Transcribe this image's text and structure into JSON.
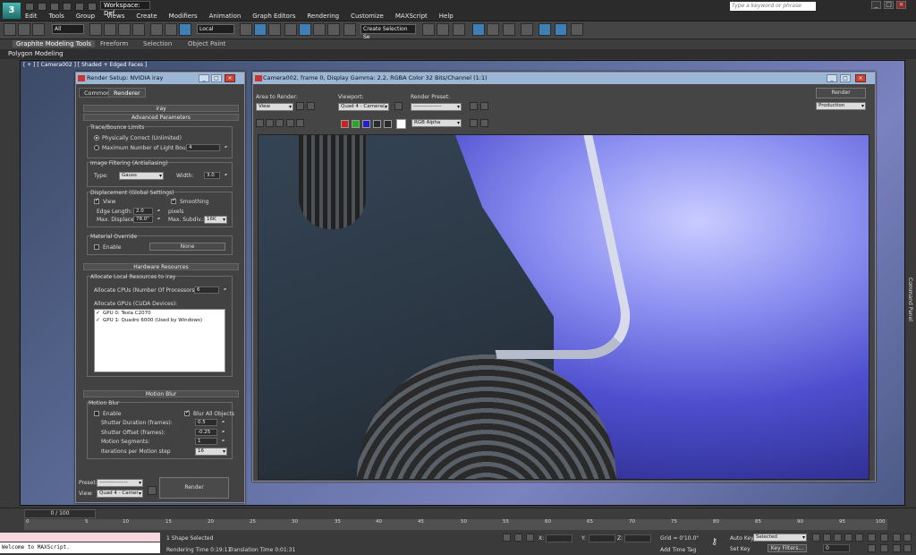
{
  "app": {
    "workspace": "Workspace: Def",
    "search_placeholder": "Type a keyword or phrase",
    "menu": [
      "Edit",
      "Tools",
      "Group",
      "Views",
      "Create",
      "Modifiers",
      "Animation",
      "Graph Editors",
      "Rendering",
      "Customize",
      "MAXScript",
      "Help"
    ]
  },
  "toolbar": {
    "filter_value": "All",
    "coord_value": "Local",
    "selection_set": "Create Selection Se"
  },
  "ribbon": {
    "tabs": [
      "Graphite Modeling Tools",
      "Freeform",
      "Selection",
      "Object Paint"
    ],
    "subbar": "Polygon Modeling"
  },
  "viewport": {
    "label": "[ + ] [ Camera002 ] [ Shaded + Edged Faces ]",
    "command_panel": "Command Panel"
  },
  "render_setup": {
    "title": "Render Setup: NVIDIA iray",
    "tabs": [
      "Common",
      "Renderer"
    ],
    "iray_header": "iray",
    "advanced_header": "Advanced Parameters",
    "trace_group": "Trace/Bounce Limits",
    "physically_correct": "Physically Correct (Unlimited)",
    "max_bounces": "Maximum Number of Light Bounces",
    "max_bounces_value": "4",
    "filtering_group": "Image Filtering (Antialiasing)",
    "type_label": "Type:",
    "type_value": "Gauss",
    "width_label": "Width:",
    "width_value": "3.0",
    "displacement_group": "Displacement (Global Settings)",
    "view_label": "View",
    "smoothing_label": "Smoothing",
    "edge_length_label": "Edge Length:",
    "edge_length_value": "2.0",
    "pixels_label": "pixels",
    "max_displace_label": "Max. Displace:",
    "max_displace_value": "78.0\"",
    "max_subdiv_label": "Max. Subdiv.:",
    "max_subdiv_value": "16K",
    "material_override_group": "Material Override",
    "enable_label": "Enable",
    "none_button": "None",
    "hardware_header": "Hardware Resources",
    "allocate_local": "Allocate Local Resources to iray",
    "allocate_cpus_label": "Allocate CPUs (Number Of Processors):",
    "allocate_cpus_value": "6",
    "allocate_gpus_label": "Allocate GPUs (CUDA Devices):",
    "gpus": [
      "GPU 0: Tesla C2070",
      "GPU 1: Quadro 6000 (Used by Windows)"
    ],
    "motion_header": "Motion Blur",
    "motion_group": "Motion Blur",
    "mb_enable": "Enable",
    "blur_all": "Blur All Objects",
    "shutter_duration_label": "Shutter Duration (frames):",
    "shutter_duration_value": "0.5",
    "shutter_offset_label": "Shutter Offset (frames):",
    "shutter_offset_value": "-0.25",
    "motion_segments_label": "Motion Segments:",
    "motion_segments_value": "1",
    "iterations_label": "Iterations per Motion step",
    "iterations_value": "16",
    "preset_label": "Preset:",
    "preset_value": "----------------",
    "view_bottom_label": "View:",
    "view_bottom_value": "Quad 4 - Camer",
    "render_button": "Render"
  },
  "render_frame": {
    "title": "Camera002, frame 0, Display Gamma: 2.2, RGBA Color 32 Bits/Channel (1:1)",
    "area_label": "Area to Render:",
    "area_value": "View",
    "viewport_label": "Viewport:",
    "viewport_value": "Quad 4 - Camera(",
    "preset_label": "Render Preset:",
    "preset_value": "----------------",
    "render_button": "Render",
    "mode_value": "Production",
    "channel_value": "RGB Alpha"
  },
  "timeline": {
    "slider": "0 / 100",
    "ticks": [
      "0",
      "5",
      "10",
      "15",
      "20",
      "25",
      "30",
      "35",
      "40",
      "45",
      "50",
      "55",
      "60",
      "65",
      "70",
      "75",
      "80",
      "85",
      "90",
      "95",
      "100"
    ]
  },
  "status": {
    "listener_top": "",
    "listener_bottom": "Welcome to MAXScript.",
    "selected": "1 Shape Selected",
    "render_time": "Rendering Time  0:19:11",
    "translation_time": "Translation Time  0:01:31",
    "x_label": "X:",
    "y_label": "Y:",
    "z_label": "Z:",
    "grid": "Grid = 0'10.0\"",
    "add_time_tag": "Add Time Tag",
    "auto_key": "Auto Key",
    "auto_key_value": "Selected",
    "set_key": "Set Key",
    "key_filters": "Key Filters...",
    "frame_value": "0"
  }
}
